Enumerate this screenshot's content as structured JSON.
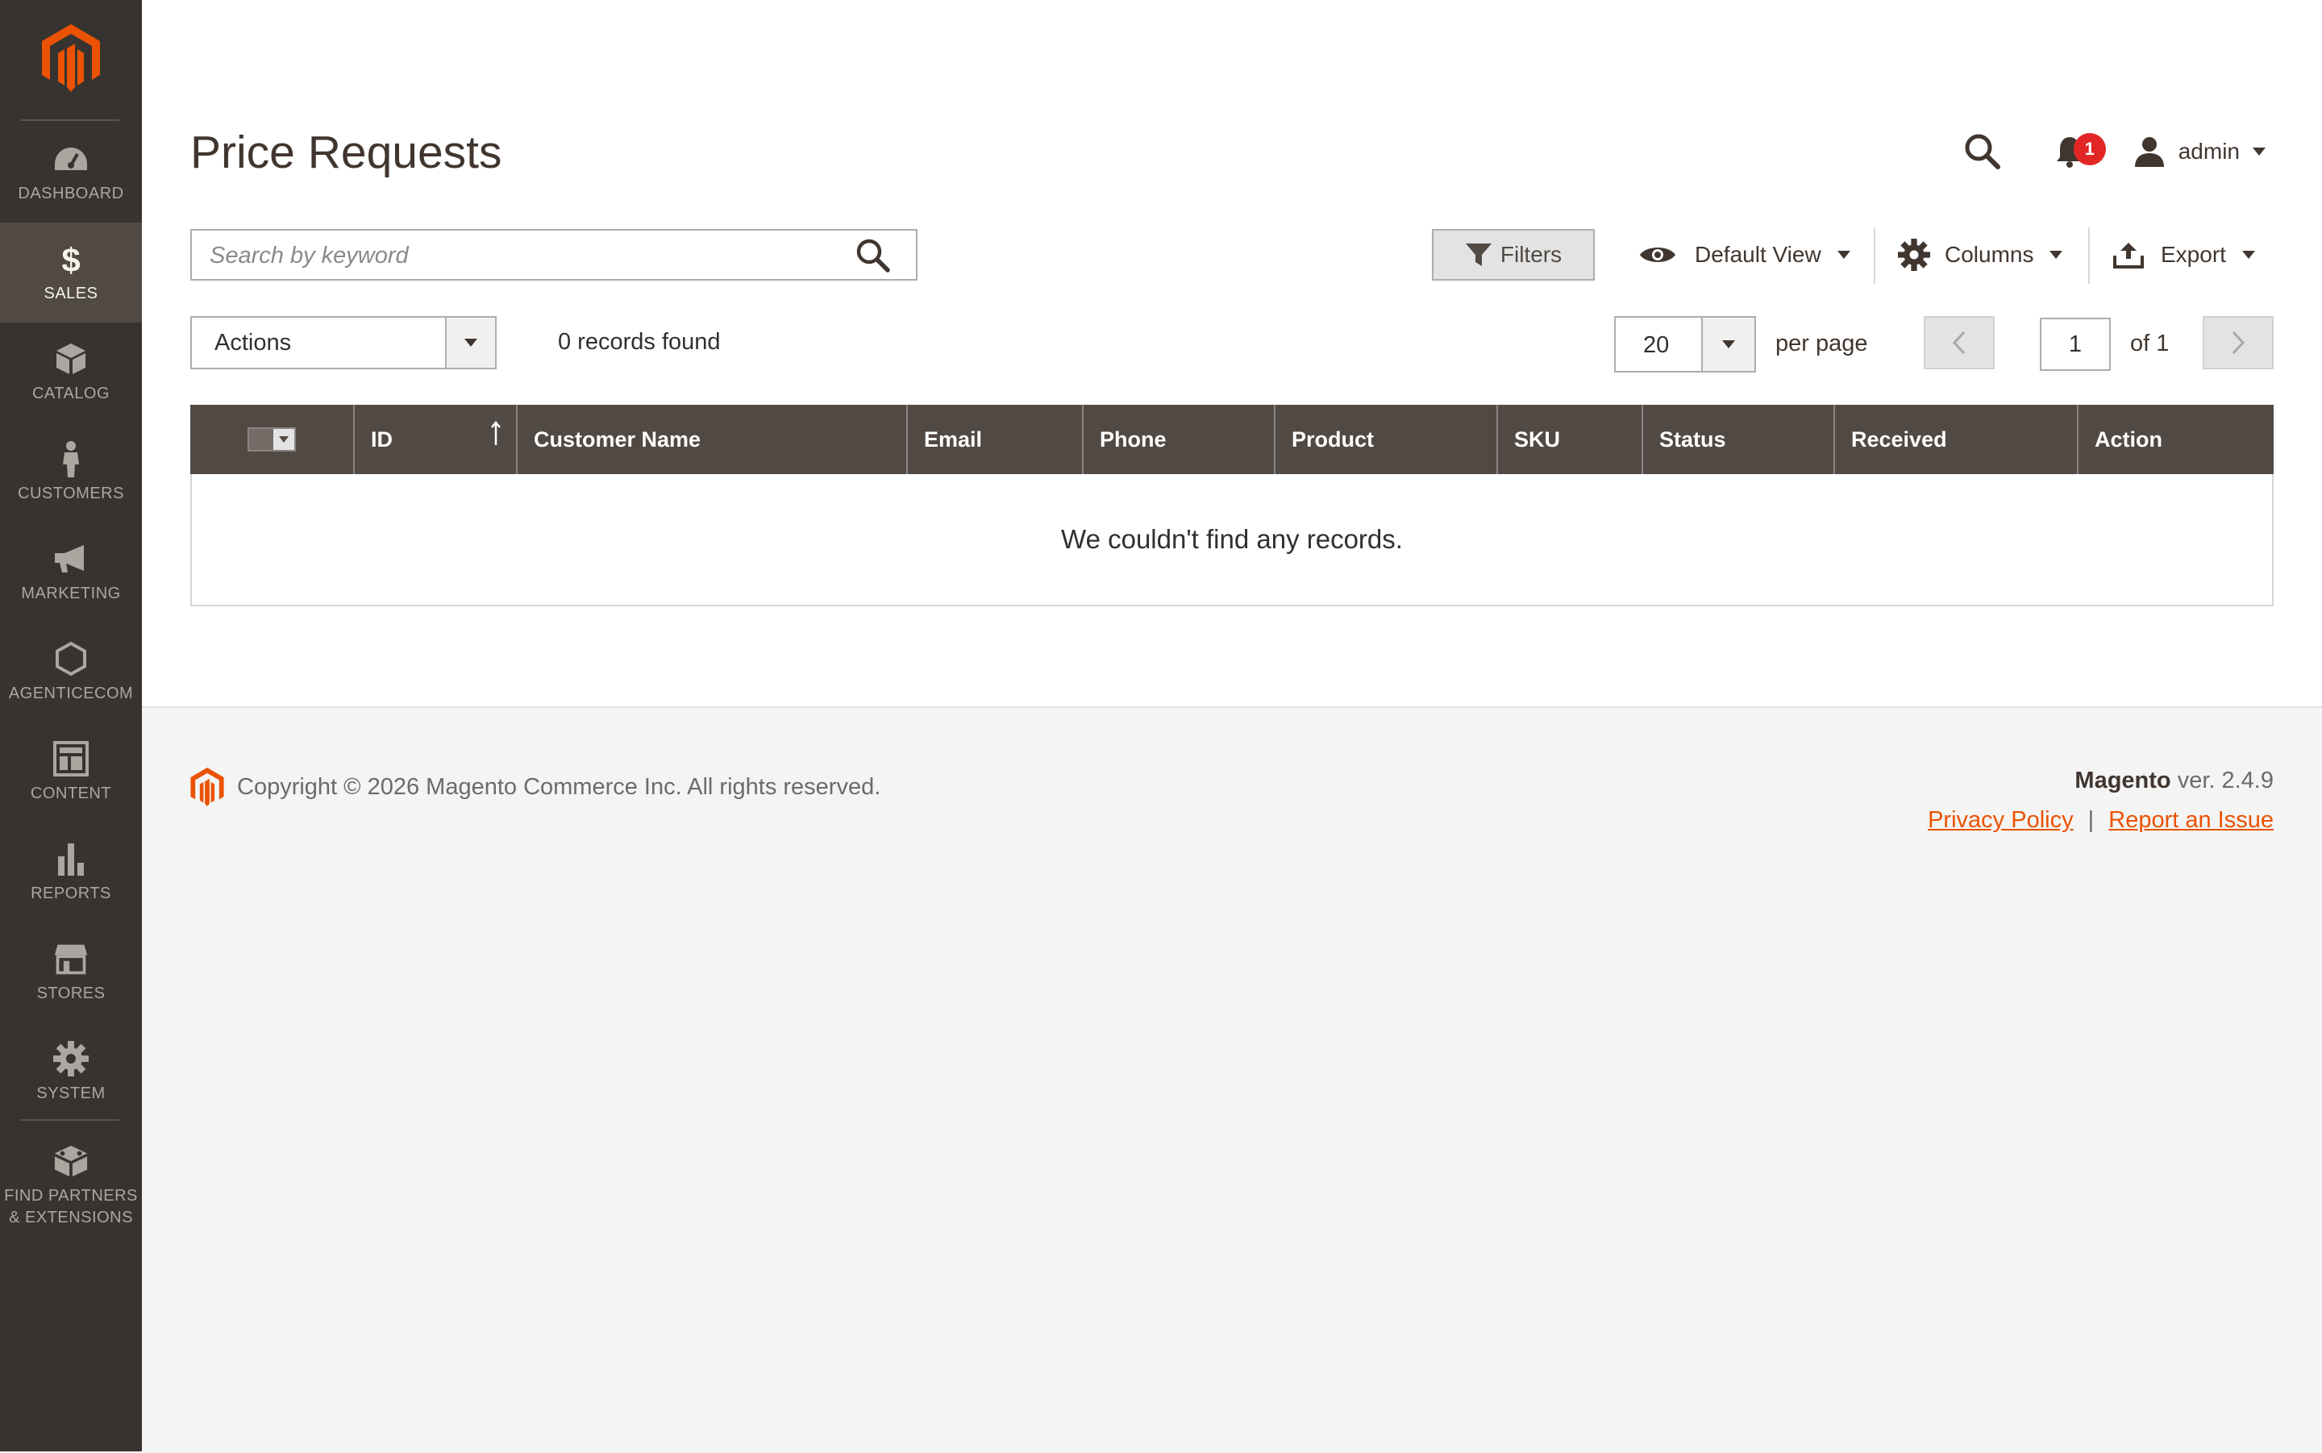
{
  "brand": {
    "accent_color": "#eb5202",
    "sidebar_color": "#373330"
  },
  "sidebar": {
    "items": [
      {
        "label": "DASHBOARD",
        "icon": "dashboard-icon"
      },
      {
        "label": "SALES",
        "icon": "dollar-icon",
        "active": true
      },
      {
        "label": "CATALOG",
        "icon": "box-icon"
      },
      {
        "label": "CUSTOMERS",
        "icon": "person-icon"
      },
      {
        "label": "MARKETING",
        "icon": "megaphone-icon"
      },
      {
        "label": "AGENTICECOM",
        "icon": "hexagon-icon"
      },
      {
        "label": "CONTENT",
        "icon": "layout-icon"
      },
      {
        "label": "REPORTS",
        "icon": "bar-chart-icon"
      },
      {
        "label": "STORES",
        "icon": "store-icon"
      },
      {
        "label": "SYSTEM",
        "icon": "gear-icon"
      },
      {
        "label": "FIND PARTNERS\n& EXTENSIONS",
        "icon": "extensions-icon"
      }
    ]
  },
  "header": {
    "title": "Price Requests",
    "notifications_count": "1",
    "user_name": "admin"
  },
  "search": {
    "placeholder": "Search by keyword",
    "value": ""
  },
  "toolbar": {
    "filters_label": "Filters",
    "view_label": "Default View",
    "columns_label": "Columns",
    "export_label": "Export"
  },
  "actions": {
    "label": "Actions",
    "records_found": "0 records found"
  },
  "pager": {
    "per_page_value": "20",
    "per_page_label": "per page",
    "current_page": "1",
    "of_label": "of 1"
  },
  "grid": {
    "columns": [
      "ID",
      "Customer Name",
      "Email",
      "Phone",
      "Product",
      "SKU",
      "Status",
      "Received",
      "Action"
    ],
    "sorted_column": "ID",
    "sort_direction": "ascending",
    "rows": [],
    "empty_message": "We couldn't find any records."
  },
  "footer": {
    "copyright": "Copyright © 2026 Magento Commerce Inc. All rights reserved.",
    "brand_name": "Magento",
    "version": " ver. 2.4.9",
    "privacy_link": "Privacy Policy",
    "separator": "|",
    "report_link": "Report an Issue"
  }
}
